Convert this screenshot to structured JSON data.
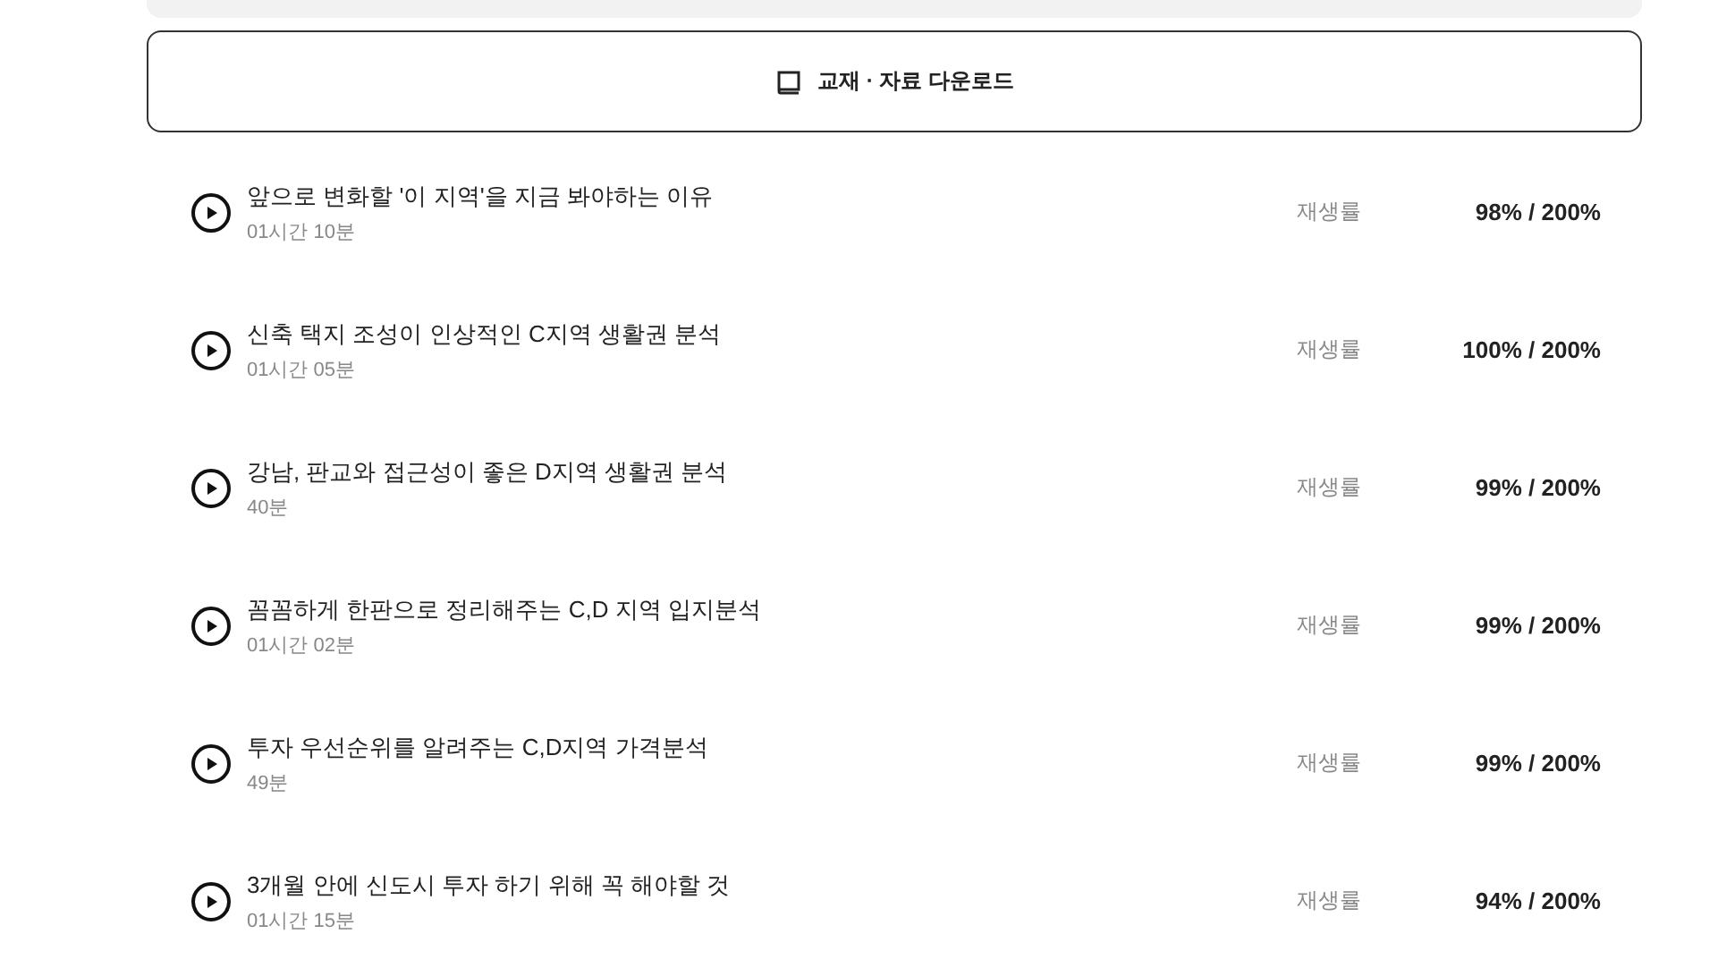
{
  "download_button": {
    "label": "교재 · 자료 다운로드"
  },
  "lessons": [
    {
      "title": "앞으로 변화할 '이 지역'을 지금 봐야하는 이유",
      "duration": "01시간 10분",
      "rate_label": "재생률",
      "rate": "98% / 200%"
    },
    {
      "title": "신축 택지 조성이 인상적인 C지역 생활권 분석",
      "duration": "01시간 05분",
      "rate_label": "재생률",
      "rate": "100% / 200%"
    },
    {
      "title": "강남, 판교와 접근성이 좋은 D지역 생활권 분석",
      "duration": "40분",
      "rate_label": "재생률",
      "rate": "99% / 200%"
    },
    {
      "title": "꼼꼼하게 한판으로 정리해주는 C,D 지역 입지분석",
      "duration": "01시간 02분",
      "rate_label": "재생률",
      "rate": "99% / 200%"
    },
    {
      "title": "투자 우선순위를 알려주는 C,D지역 가격분석",
      "duration": "49분",
      "rate_label": "재생률",
      "rate": "99% / 200%"
    },
    {
      "title": "3개월 안에 신도시 투자 하기 위해 꼭 해야할 것",
      "duration": "01시간 15분",
      "rate_label": "재생률",
      "rate": "94% / 200%"
    }
  ]
}
